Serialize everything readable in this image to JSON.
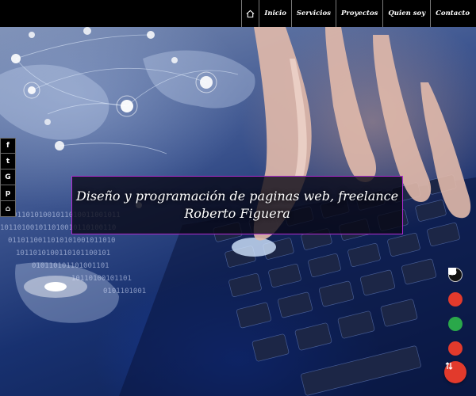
{
  "nav": {
    "items": [
      "Inicio",
      "Servicios",
      "Proyectos",
      "Quien soy",
      "Contacto"
    ]
  },
  "hero": {
    "headline": "Diseño y programación de paginas web, freelance Roberto Figuera"
  },
  "social": {
    "icons": [
      "facebook-icon",
      "twitter-icon",
      "google-plus-icon",
      "pinterest-icon",
      "home-icon"
    ],
    "glyphs": [
      "f",
      "t",
      "G",
      "p",
      "⌂"
    ]
  },
  "right_icons": [
    {
      "name": "id-card-icon",
      "color": "#111111"
    },
    {
      "name": "target-icon",
      "color": "#e23a2c"
    },
    {
      "name": "cloud-icon",
      "color": "#2aa84a"
    },
    {
      "name": "quote-icon",
      "color": "#e23a2c"
    },
    {
      "name": "store-icon",
      "color": "#2e7bd6"
    }
  ],
  "colors": {
    "topbar": "#000000",
    "headline_border": "#b02bd1",
    "scroll_button": "#e23a2c"
  }
}
